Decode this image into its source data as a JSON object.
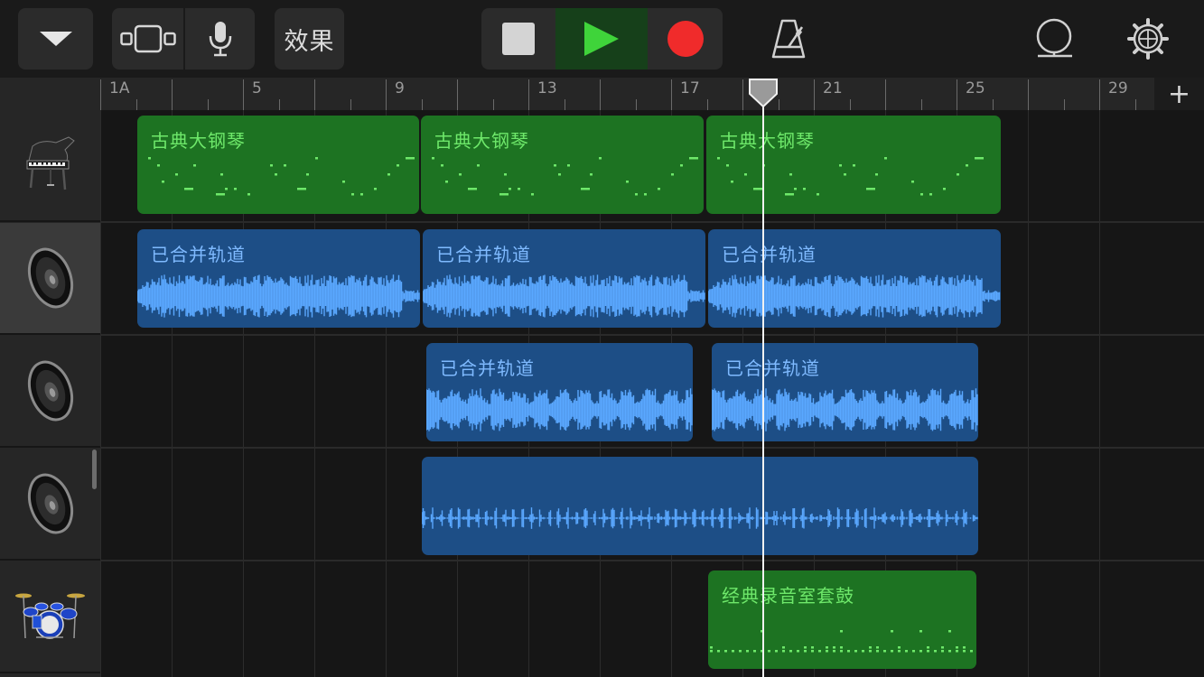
{
  "toolbar": {
    "menu_icon": "chevron-down-icon",
    "view_icon": "track-view-icon",
    "mic_icon": "microphone-icon",
    "fx_label": "效果",
    "stop_icon": "stop-icon",
    "play_icon": "play-icon",
    "record_icon": "record-icon",
    "metronome_icon": "metronome-icon",
    "loop_icon": "loop-browser-icon",
    "settings_icon": "gear-icon"
  },
  "ruler": {
    "labels": [
      "1A",
      "5",
      "9",
      "13",
      "17",
      "21",
      "25",
      "29"
    ],
    "add_label": "+"
  },
  "tracks": [
    {
      "instrument": "grand-piano-icon",
      "regions": [
        {
          "type": "midi",
          "label": "古典大钢琴"
        },
        {
          "type": "midi",
          "label": "古典大钢琴"
        },
        {
          "type": "midi",
          "label": "古典大钢琴"
        }
      ]
    },
    {
      "instrument": "speaker-icon",
      "selected": true,
      "regions": [
        {
          "type": "audio",
          "label": "已合并轨道"
        },
        {
          "type": "audio",
          "label": "已合并轨道"
        },
        {
          "type": "audio",
          "label": "已合并轨道"
        }
      ]
    },
    {
      "instrument": "speaker-icon",
      "regions": [
        {
          "type": "audio",
          "label": "已合并轨道"
        },
        {
          "type": "audio",
          "label": "已合并轨道"
        }
      ]
    },
    {
      "instrument": "speaker-icon",
      "regions": [
        {
          "type": "audio",
          "label": ""
        }
      ]
    },
    {
      "instrument": "drum-kit-icon",
      "regions": [
        {
          "type": "midi",
          "label": "经典录音室套鼓"
        }
      ]
    }
  ],
  "colors": {
    "midi_region": "#1d7322",
    "midi_text": "#6ee86a",
    "audio_region": "#1d4e86",
    "audio_text": "#7fbaff",
    "record": "#f02b2b",
    "play": "#3fd43a"
  }
}
